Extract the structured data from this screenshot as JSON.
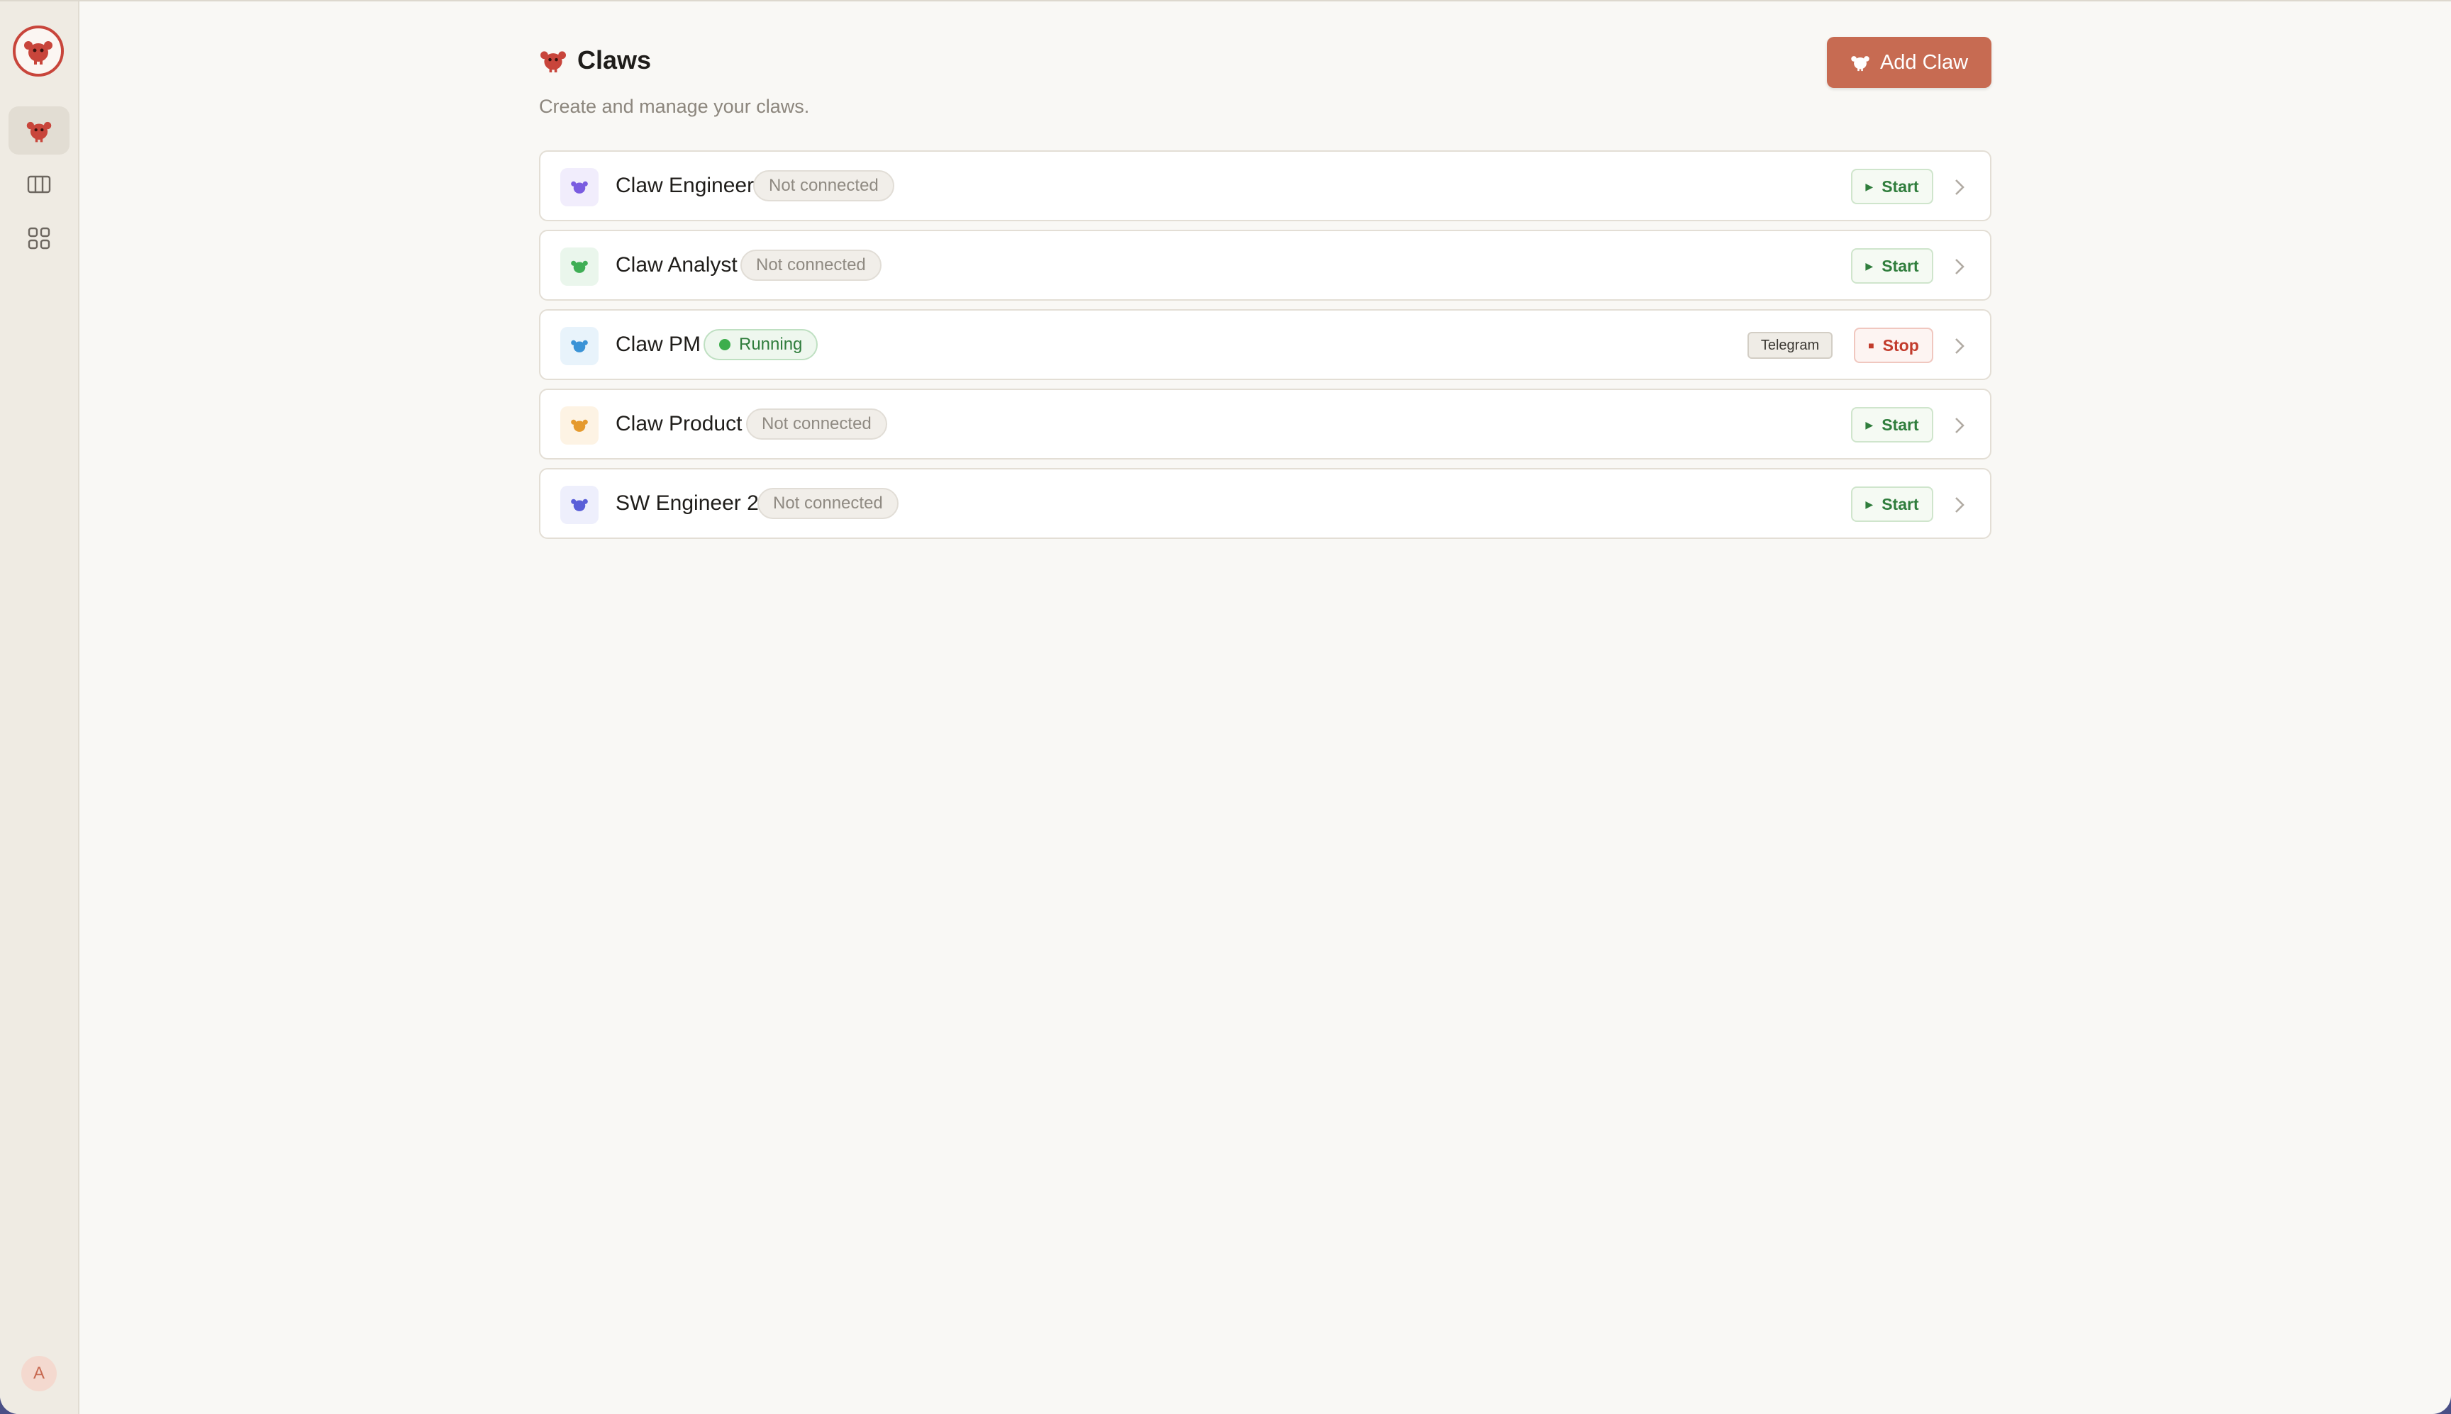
{
  "app": {
    "avatar_initial": "A",
    "accent_color": "#c76b52"
  },
  "header": {
    "title": "Claws",
    "subtitle": "Create and manage your claws.",
    "add_button_label": "Add Claw"
  },
  "claws": [
    {
      "name": "Claw Engineer",
      "status": "Not connected",
      "icon_color": "#7a5ce0",
      "icon_bg": "#f1edfc",
      "action": "Start"
    },
    {
      "name": "Claw Analyst",
      "status": "Not connected",
      "icon_color": "#3fae55",
      "icon_bg": "#eaf6ec",
      "action": "Start"
    },
    {
      "name": "Claw PM",
      "status": "Running",
      "icon_color": "#3b93d6",
      "icon_bg": "#e8f3fb",
      "tag": "Telegram",
      "action": "Stop"
    },
    {
      "name": "Claw Product",
      "status": "Not connected",
      "icon_color": "#e59a2e",
      "icon_bg": "#fdf3e4",
      "action": "Start"
    },
    {
      "name": "SW Engineer 2",
      "status": "Not connected",
      "icon_color": "#5a5fd8",
      "icon_bg": "#eeeffc",
      "action": "Start"
    }
  ]
}
